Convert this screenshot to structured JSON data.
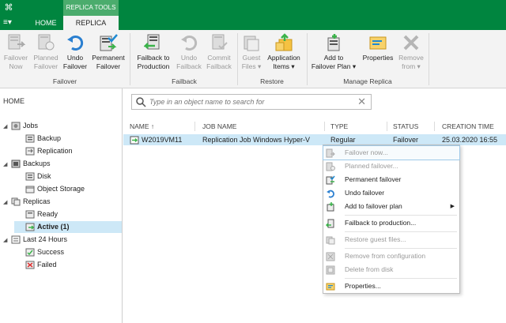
{
  "titlebar": {
    "context_tab": "REPLICA TOOLS"
  },
  "tabs": {
    "home": "HOME",
    "replica": "REPLICA",
    "menu": "≡▾"
  },
  "ribbon": {
    "failover_now": "Failover\nNow",
    "planned_failover": "Planned\nFailover",
    "undo_failover": "Undo\nFailover",
    "permanent_failover": "Permanent\nFailover",
    "failback_to_production": "Failback to\nProduction",
    "undo_failback": "Undo\nFailback",
    "commit_failback": "Commit\nFailback",
    "guest_files": "Guest\nFiles ▾",
    "application_items": "Application\nItems ▾",
    "add_to_failover_plan": "Add to\nFailover Plan ▾",
    "properties": "Properties",
    "remove_from": "Remove\nfrom ▾",
    "groups": {
      "failover": "Failover",
      "failback": "Failback",
      "restore": "Restore",
      "manage_replica": "Manage Replica"
    }
  },
  "nav": {
    "header": "HOME",
    "items": [
      {
        "label": "Jobs"
      },
      {
        "label": "Backup"
      },
      {
        "label": "Replication"
      },
      {
        "label": "Backups"
      },
      {
        "label": "Disk"
      },
      {
        "label": "Object Storage"
      },
      {
        "label": "Replicas"
      },
      {
        "label": "Ready"
      },
      {
        "label": "Active (1)"
      },
      {
        "label": "Last 24 Hours"
      },
      {
        "label": "Success"
      },
      {
        "label": "Failed"
      }
    ]
  },
  "search": {
    "placeholder": "Type in an object name to search for"
  },
  "table": {
    "columns": [
      "NAME ↑",
      "JOB NAME",
      "TYPE",
      "STATUS",
      "CREATION TIME"
    ],
    "rows": [
      {
        "name": "W2019VM11",
        "job_name": "Replication Job Windows Hyper-V",
        "type": "Regular",
        "status": "Failover",
        "creation_time": "25.03.2020 16:55"
      }
    ]
  },
  "context_menu": {
    "items": [
      {
        "label": "Failover now..."
      },
      {
        "label": "Planned failover..."
      },
      {
        "label": "Permanent failover"
      },
      {
        "label": "Undo failover"
      },
      {
        "label": "Add to failover plan"
      },
      {
        "label": "Failback to production..."
      },
      {
        "label": "Restore guest files..."
      },
      {
        "label": "Remove from configuration"
      },
      {
        "label": "Delete from disk"
      },
      {
        "label": "Properties..."
      }
    ]
  },
  "colors": {
    "brand_green": "#00853f",
    "selection_blue": "#cde8f7"
  }
}
